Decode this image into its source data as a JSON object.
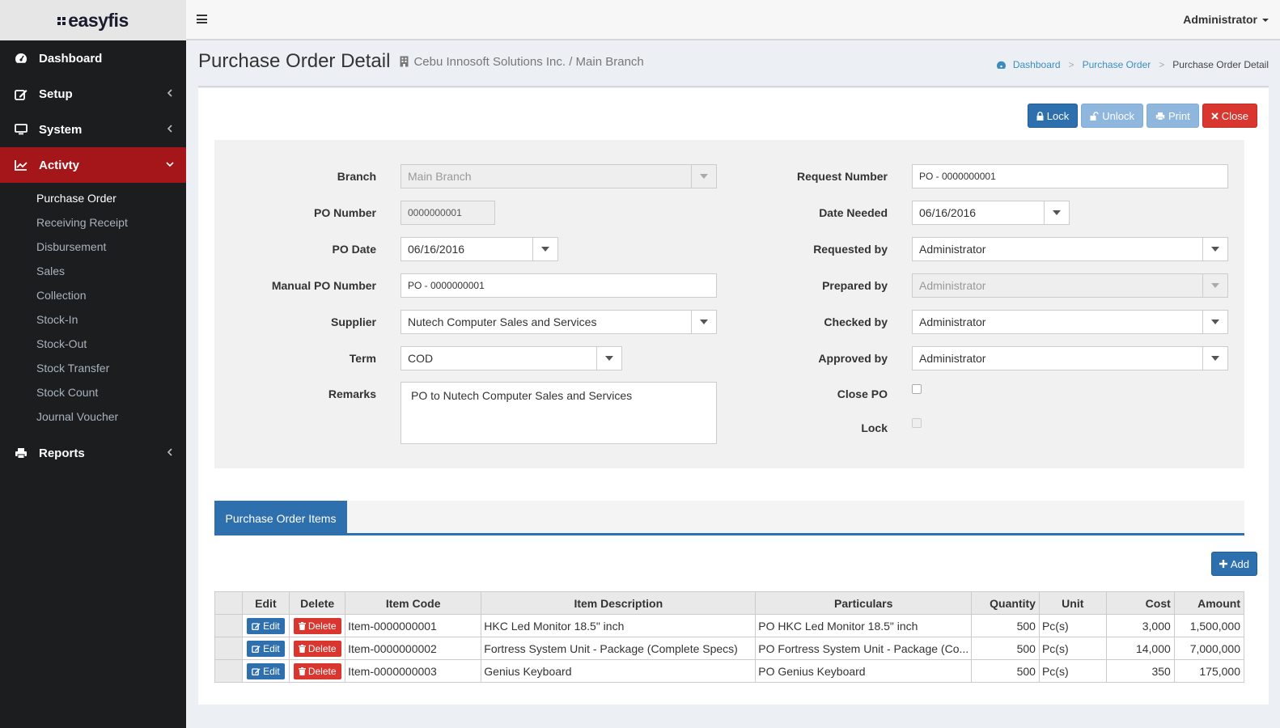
{
  "app": {
    "logo": "easyfis"
  },
  "sidebar": {
    "items": [
      {
        "label": "Dashboard",
        "icon": "dashboard-icon"
      },
      {
        "label": "Setup",
        "icon": "edit-icon"
      },
      {
        "label": "System",
        "icon": "monitor-icon"
      },
      {
        "label": "Activty",
        "icon": "line-chart-icon"
      },
      {
        "label": "Reports",
        "icon": "print-icon"
      }
    ],
    "activity_items": [
      "Purchase Order",
      "Receiving Receipt",
      "Disbursement",
      "Sales",
      "Collection",
      "Stock-In",
      "Stock-Out",
      "Stock Transfer",
      "Stock Count",
      "Journal Voucher"
    ]
  },
  "header": {
    "user": "Administrator"
  },
  "page": {
    "title": "Purchase Order Detail",
    "subtitle": "Cebu Innosoft Solutions Inc. / Main Branch",
    "breadcrumb": [
      "Dashboard",
      "Purchase Order",
      "Purchase Order Detail"
    ]
  },
  "toolbar": {
    "lock": "Lock",
    "unlock": "Unlock",
    "print": "Print",
    "close": "Close"
  },
  "form": {
    "labels": {
      "branch": "Branch",
      "po_number": "PO Number",
      "po_date": "PO Date",
      "manual_po_number": "Manual PO Number",
      "supplier": "Supplier",
      "term": "Term",
      "remarks": "Remarks",
      "request_number": "Request Number",
      "date_needed": "Date Needed",
      "requested_by": "Requested by",
      "prepared_by": "Prepared by",
      "checked_by": "Checked by",
      "approved_by": "Approved by",
      "close_po": "Close PO",
      "lock": "Lock"
    },
    "values": {
      "branch": "Main Branch",
      "po_number": "0000000001",
      "po_date": "06/16/2016",
      "manual_po_number": "PO - 0000000001",
      "supplier": "Nutech Computer Sales and Services",
      "term": "COD",
      "remarks": "PO to Nutech Computer Sales and Services",
      "request_number": "PO - 0000000001",
      "date_needed": "06/16/2016",
      "requested_by": "Administrator",
      "prepared_by": "Administrator",
      "checked_by": "Administrator",
      "approved_by": "Administrator",
      "close_po": false,
      "lock": false
    }
  },
  "items_tab": {
    "label": "Purchase Order Items",
    "add_label": "Add"
  },
  "items_table": {
    "headers": [
      "",
      "Edit",
      "Delete",
      "Item Code",
      "Item Description",
      "Particulars",
      "Quantity",
      "Unit",
      "Cost",
      "Amount"
    ],
    "edit_label": "Edit",
    "delete_label": "Delete",
    "rows": [
      {
        "code": "Item-0000000001",
        "description": "HKC Led Monitor 18.5\" inch",
        "particulars": "PO HKC Led Monitor 18.5\" inch",
        "quantity": "500",
        "unit": "Pc(s)",
        "cost": "3,000",
        "amount": "1,500,000"
      },
      {
        "code": "Item-0000000002",
        "description": "Fortress System Unit - Package (Complete Specs)",
        "particulars": "PO Fortress System Unit - Package (Co...",
        "quantity": "500",
        "unit": "Pc(s)",
        "cost": "14,000",
        "amount": "7,000,000"
      },
      {
        "code": "Item-0000000003",
        "description": "Genius Keyboard",
        "particulars": "PO Genius Keyboard",
        "quantity": "500",
        "unit": "Pc(s)",
        "cost": "350",
        "amount": "175,000"
      }
    ]
  },
  "colors": {
    "primary": "#2e6fad",
    "danger": "#d9362f",
    "active_nav": "#a4161a",
    "sidebar_bg": "#1b1d1f"
  }
}
